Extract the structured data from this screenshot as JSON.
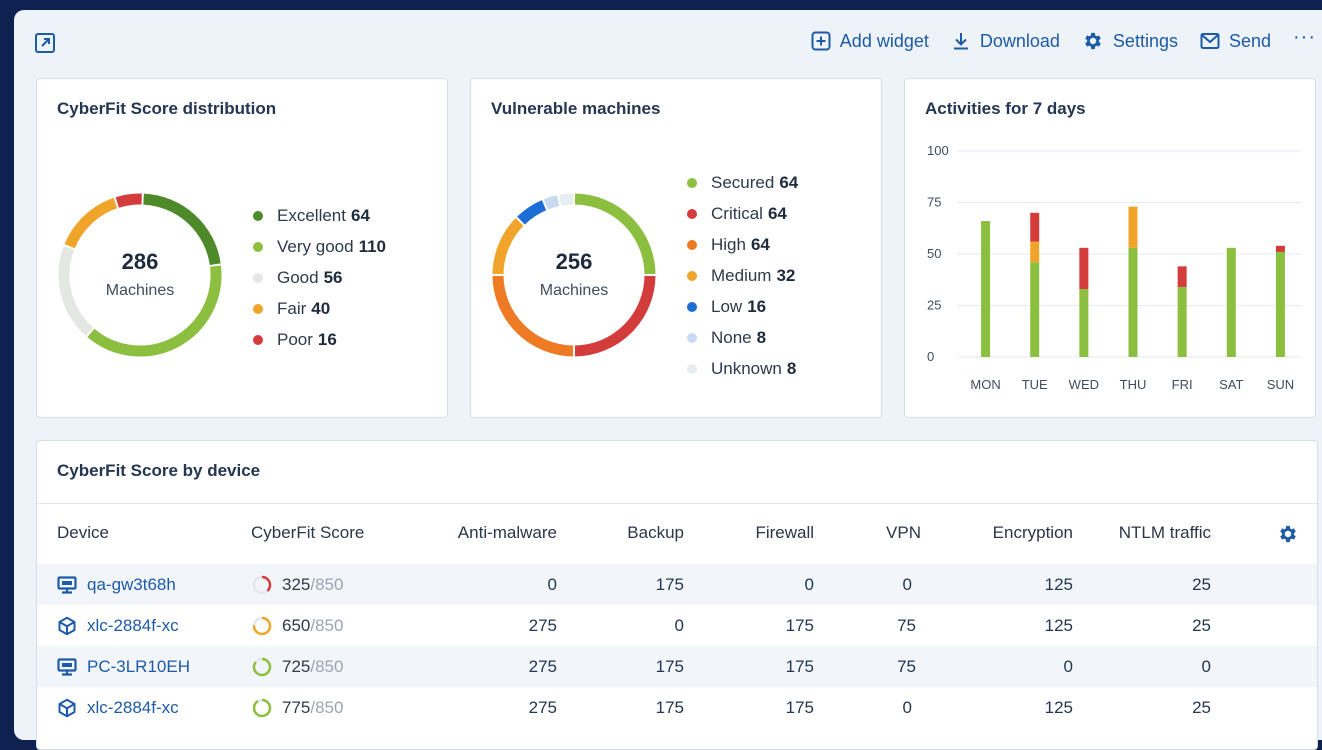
{
  "toolbar": {
    "add_widget": "Add widget",
    "download": "Download",
    "settings": "Settings",
    "send": "Send",
    "more": "···"
  },
  "cyberfit_distribution": {
    "title": "CyberFit Score distribution",
    "total": "286",
    "total_label": "Machines",
    "legend": [
      {
        "label": "Excellent",
        "value": "64",
        "color": "#4e8a2a"
      },
      {
        "label": "Very good",
        "value": "110",
        "color": "#8cbf3f"
      },
      {
        "label": "Good",
        "value": "56",
        "color": "#e3e8e2"
      },
      {
        "label": "Fair",
        "value": "40",
        "color": "#f0a52a"
      },
      {
        "label": "Poor",
        "value": "16",
        "color": "#d43c3c"
      }
    ]
  },
  "vulnerable_machines": {
    "title": "Vulnerable machines",
    "total": "256",
    "total_label": "Machines",
    "legend": [
      {
        "label": "Secured",
        "value": "64",
        "color": "#8cbf3f"
      },
      {
        "label": "Critical",
        "value": "64",
        "color": "#d43c3c"
      },
      {
        "label": "High",
        "value": "64",
        "color": "#ee7a24"
      },
      {
        "label": "Medium",
        "value": "32",
        "color": "#f0a52a"
      },
      {
        "label": "Low",
        "value": "16",
        "color": "#1c6ed4"
      },
      {
        "label": "None",
        "value": "8",
        "color": "#c9d9f2"
      },
      {
        "label": "Unknown",
        "value": "8",
        "color": "#e8edf2"
      }
    ]
  },
  "activities": {
    "title": "Activities for 7 days"
  },
  "chart_data": {
    "type": "bar",
    "stacked": true,
    "categories": [
      "MON",
      "TUE",
      "WED",
      "THU",
      "FRI",
      "SAT",
      "SUN"
    ],
    "series": [
      {
        "color": "#8cbf3f",
        "values": [
          66,
          46,
          33,
          53,
          34,
          53,
          51
        ]
      },
      {
        "color": "#f0a52a",
        "values": [
          0,
          10,
          0,
          20,
          0,
          0,
          0
        ]
      },
      {
        "color": "#d43c3c",
        "values": [
          0,
          14,
          20,
          0,
          10,
          0,
          3
        ]
      }
    ],
    "ylim": [
      0,
      100
    ],
    "yticks": [
      "0",
      "25",
      "50",
      "75",
      "100"
    ],
    "grid": true
  },
  "device_table": {
    "title": "CyberFit Score by device",
    "columns": [
      "Device",
      "CyberFit Score",
      "Anti-malware",
      "Backup",
      "Firewall",
      "VPN",
      "Encryption",
      "NTLM traffic"
    ],
    "rows": [
      {
        "device": "qa-gw3t68h",
        "type": "desktop",
        "score": "325",
        "max": "/850",
        "score_fraction": 0.38,
        "score_color": "#d43c3c",
        "anti_malware": "0",
        "backup": "175",
        "firewall": "0",
        "vpn": "0",
        "encryption": "125",
        "ntlm": "25"
      },
      {
        "device": "xlc-2884f-xc",
        "type": "cube",
        "score": "650",
        "max": "/850",
        "score_fraction": 0.76,
        "score_color": "#f0a52a",
        "anti_malware": "275",
        "backup": "0",
        "firewall": "175",
        "vpn": "75",
        "encryption": "125",
        "ntlm": "25"
      },
      {
        "device": "PC-3LR10EH",
        "type": "desktop",
        "score": "725",
        "max": "/850",
        "score_fraction": 0.85,
        "score_color": "#8cbf3f",
        "anti_malware": "275",
        "backup": "175",
        "firewall": "175",
        "vpn": "75",
        "encryption": "0",
        "ntlm": "0"
      },
      {
        "device": "xlc-2884f-xc",
        "type": "cube",
        "score": "775",
        "max": "/850",
        "score_fraction": 0.91,
        "score_color": "#8cbf3f",
        "anti_malware": "275",
        "backup": "175",
        "firewall": "175",
        "vpn": "0",
        "encryption": "125",
        "ntlm": "25"
      }
    ]
  }
}
